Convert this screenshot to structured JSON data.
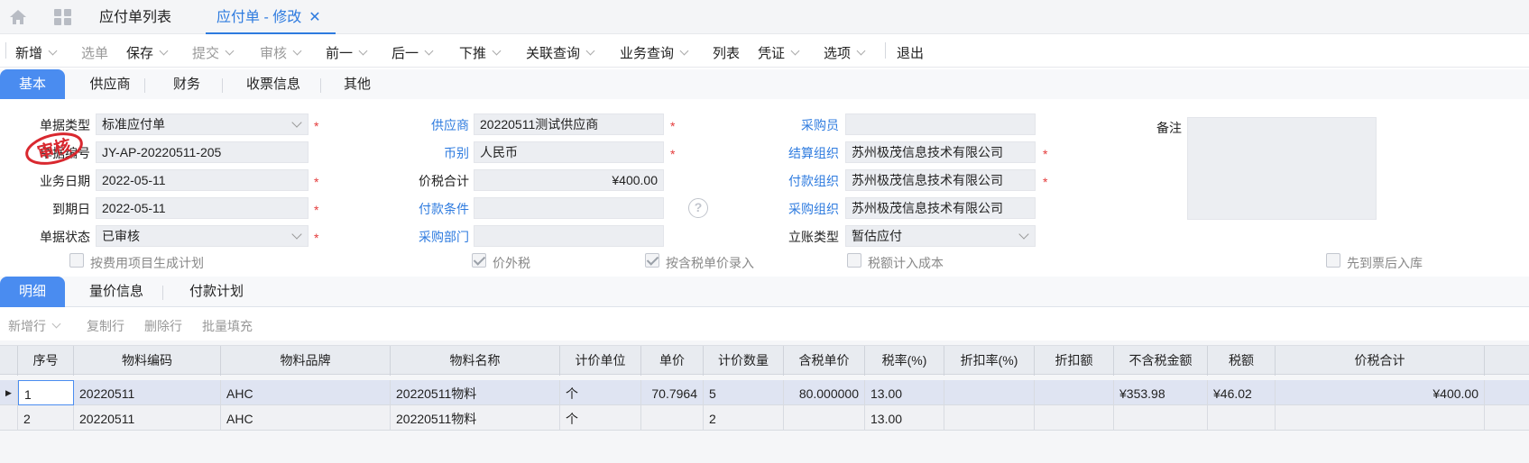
{
  "tabs": {
    "home_icon": "home-icon",
    "apps_icon": "grid-icon",
    "list_tab": "应付单列表",
    "edit_tab": "应付单 - 修改",
    "close": "✕"
  },
  "toolbar": {
    "new": "新增",
    "select_bill": "选单",
    "save": "保存",
    "submit": "提交",
    "audit": "审核",
    "prev": "前一",
    "next": "后一",
    "push_down": "下推",
    "related_query": "关联查询",
    "business_query": "业务查询",
    "list": "列表",
    "voucher": "凭证",
    "options": "选项",
    "exit": "退出"
  },
  "section_tabs": [
    "基本",
    "供应商",
    "财务",
    "收票信息",
    "其他"
  ],
  "form": {
    "bill_type_label": "单据类型",
    "bill_type_value": "标准应付单",
    "bill_no_label": "单据编号",
    "bill_no_value": "JY-AP-20220511-205",
    "biz_date_label": "业务日期",
    "biz_date_value": "2022-05-11",
    "due_date_label": "到期日",
    "due_date_value": "2022-05-11",
    "bill_status_label": "单据状态",
    "bill_status_value": "已审核",
    "supplier_label": "供应商",
    "supplier_value": "20220511测试供应商",
    "currency_label": "币别",
    "currency_value": "人民币",
    "total_label": "价税合计",
    "total_value": "¥400.00",
    "pay_terms_label": "付款条件",
    "pay_terms_value": "",
    "purchase_dept_label": "采购部门",
    "purchase_dept_value": "",
    "buyer_label": "采购员",
    "buyer_value": "",
    "settle_org_label": "结算组织",
    "settle_org_value": "苏州极茂信息技术有限公司",
    "pay_org_label": "付款组织",
    "pay_org_value": "苏州极茂信息技术有限公司",
    "purchase_org_label": "采购组织",
    "purchase_org_value": "苏州极茂信息技术有限公司",
    "account_type_label": "立账类型",
    "account_type_value": "暂估应付",
    "remark_label": "备注",
    "stamp_text": "审核",
    "required_mark": "*",
    "help_mark": "?"
  },
  "checkboxes": {
    "gen_plan": "按费用项目生成计划",
    "tax_excluded": "价外税",
    "tax_price_entry": "按含税单价录入",
    "tax_in_cost": "税额计入成本",
    "invoice_first": "先到票后入库"
  },
  "detail_tabs": [
    "明细",
    "量价信息",
    "付款计划"
  ],
  "row_tools": {
    "add_row": "新增行",
    "copy_row": "复制行",
    "delete_row": "删除行",
    "batch_fill": "批量填充"
  },
  "grid": {
    "headers": [
      "序号",
      "物料编码",
      "物料品牌",
      "物料名称",
      "计价单位",
      "单价",
      "计价数量",
      "含税单价",
      "税率(%)",
      "折扣率(%)",
      "折扣额",
      "不含税金额",
      "税额",
      "价税合计"
    ],
    "rows": [
      [
        "1",
        "20220511",
        "AHC",
        "20220511物料",
        "个",
        "70.7964",
        "5",
        "80.000000",
        "13.00",
        "",
        "",
        "¥353.98",
        "¥46.02",
        "¥400.00"
      ],
      [
        "2",
        "20220511",
        "AHC",
        "20220511物料",
        "个",
        "",
        "2",
        "",
        "13.00",
        "",
        "",
        "",
        "",
        ""
      ]
    ]
  },
  "colors": {
    "accent": "#2e7bdf",
    "tab_active_bg": "#4a8cf0",
    "required": "#e43b3b",
    "stamp": "#d9282f"
  }
}
